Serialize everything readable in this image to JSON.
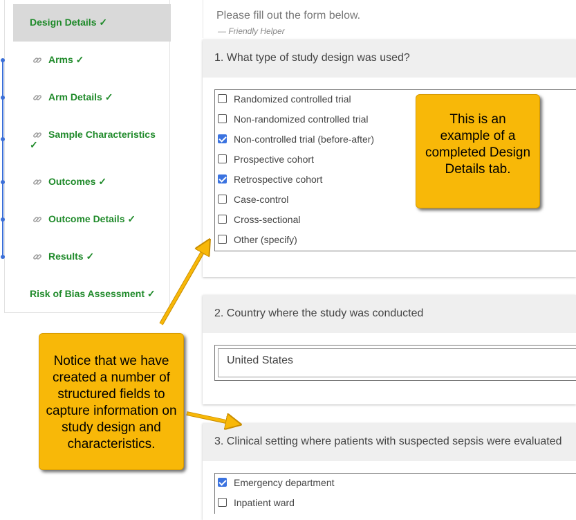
{
  "sidebar": {
    "items": [
      {
        "label": "Design Details ✓",
        "active": true,
        "icon": null
      },
      {
        "label": "Arms ✓",
        "icon": "link-icon"
      },
      {
        "label": "Arm Details ✓",
        "icon": "link-icon"
      },
      {
        "label": "Sample Characteristics",
        "label2": "✓",
        "icon": "link-icon"
      },
      {
        "label": "Outcomes ✓",
        "icon": "link-icon"
      },
      {
        "label": "Outcome Details ✓",
        "icon": "link-icon"
      },
      {
        "label": "Results ✓",
        "icon": "link-icon"
      },
      {
        "label": "Risk of Bias Assessment ✓",
        "icon": null
      }
    ]
  },
  "main": {
    "intro": "Please fill out the form below.",
    "helper": "— Friendly Helper",
    "q1": {
      "title": "1. What type of study design was used?",
      "options": [
        {
          "label": "Randomized controlled trial",
          "checked": false
        },
        {
          "label": "Non-randomized controlled trial",
          "checked": false
        },
        {
          "label": "Non-controlled trial (before-after)",
          "checked": true
        },
        {
          "label": "Prospective cohort",
          "checked": false
        },
        {
          "label": "Retrospective cohort",
          "checked": true
        },
        {
          "label": "Case-control",
          "checked": false
        },
        {
          "label": "Cross-sectional",
          "checked": false
        },
        {
          "label": "Other (specify)",
          "checked": false
        }
      ]
    },
    "q2": {
      "title": "2. Country where the study was conducted",
      "value": "United States"
    },
    "q3": {
      "title": "3. Clinical setting where patients with suspected sepsis were evaluated",
      "options": [
        {
          "label": "Emergency department",
          "checked": true
        },
        {
          "label": "Inpatient ward",
          "checked": false
        }
      ]
    }
  },
  "callouts": {
    "right": "This is an example of a completed Design Details tab.",
    "left": "Notice that we have created a number of structured fields to capture information on study design and characteristics."
  },
  "colors": {
    "accent": "#3b73e0",
    "nav_green": "#1f8a2a",
    "callout": "#f8b808"
  }
}
